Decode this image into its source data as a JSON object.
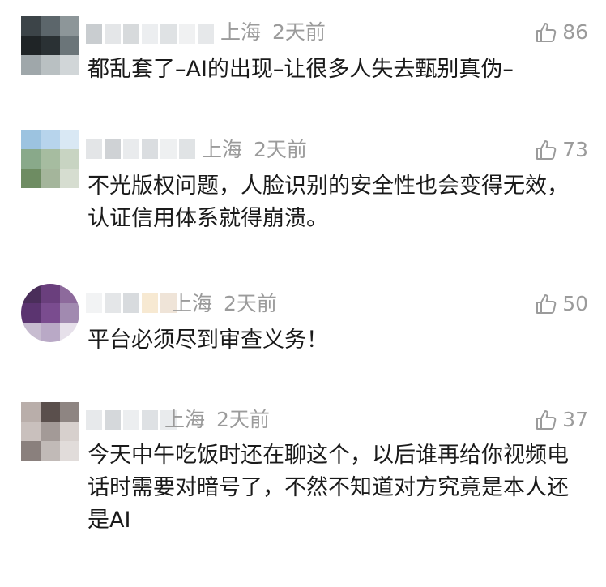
{
  "comments": [
    {
      "location": "上海",
      "time": "2天前",
      "likes": "86",
      "text": "都乱套了–AI的出现–让很多人失去甄别真伪–",
      "avatar_colors": [
        "#3c4448",
        "#5c666b",
        "#8d9699",
        "#1f2426",
        "#2a3134",
        "#6b7579",
        "#9fa7aa",
        "#b9c0c2",
        "#d1d6d8"
      ],
      "username_colors": [
        "#c9cdd0",
        "#e4e6e8",
        "#d7dadc",
        "#eceef0",
        "#dfe2e4",
        "#f0f1f2",
        "#e6e8ea"
      ]
    },
    {
      "location": "上海",
      "time": "2天前",
      "likes": "73",
      "text": "不光版权问题，人脸识别的安全性也会变得无效，认证信用体系就得崩溃。",
      "avatar_colors": [
        "#9cc3e0",
        "#b7d4ec",
        "#d9e8f4",
        "#89a98a",
        "#a6bca0",
        "#c8d4c2",
        "#6e8c62",
        "#a4b59b",
        "#d6ddd0"
      ],
      "username_colors": [
        "#e3e5e7",
        "#cfd2d5",
        "#e9ebed",
        "#dadde0",
        "#eef0f1",
        "#e0e3e5"
      ]
    },
    {
      "location": "上海",
      "time": "2天前",
      "likes": "50",
      "text": "平台必须尽到审查义务！",
      "avatar_colors": [
        "#4a2e5a",
        "#6a3f7d",
        "#8d6a9c",
        "#5b3470",
        "#7a4c8f",
        "#a18ab0",
        "#c7bcd0",
        "#b9a9c6",
        "#e6e0ea"
      ],
      "username_colors": [
        "#f2f3f4",
        "#e4e6e8",
        "#d8dbde",
        "#f7e9d2",
        "#efe4d8"
      ]
    },
    {
      "location": "上海",
      "time": "2天前",
      "likes": "37",
      "text": "今天中午吃饭时还在聊这个，以后谁再给你视频电话时需要对暗号了，不然不知道对方究竟是本人还是AI",
      "avatar_colors": [
        "#b9aeaa",
        "#5a4f4c",
        "#8e8582",
        "#c9c0bd",
        "#a39a97",
        "#d7d0cd",
        "#8a807d",
        "#c1bab7",
        "#e1dcda"
      ],
      "username_colors": [
        "#e7e9eb",
        "#d5d8db",
        "#eceef0",
        "#dee1e4",
        "#e9ebed"
      ]
    }
  ]
}
